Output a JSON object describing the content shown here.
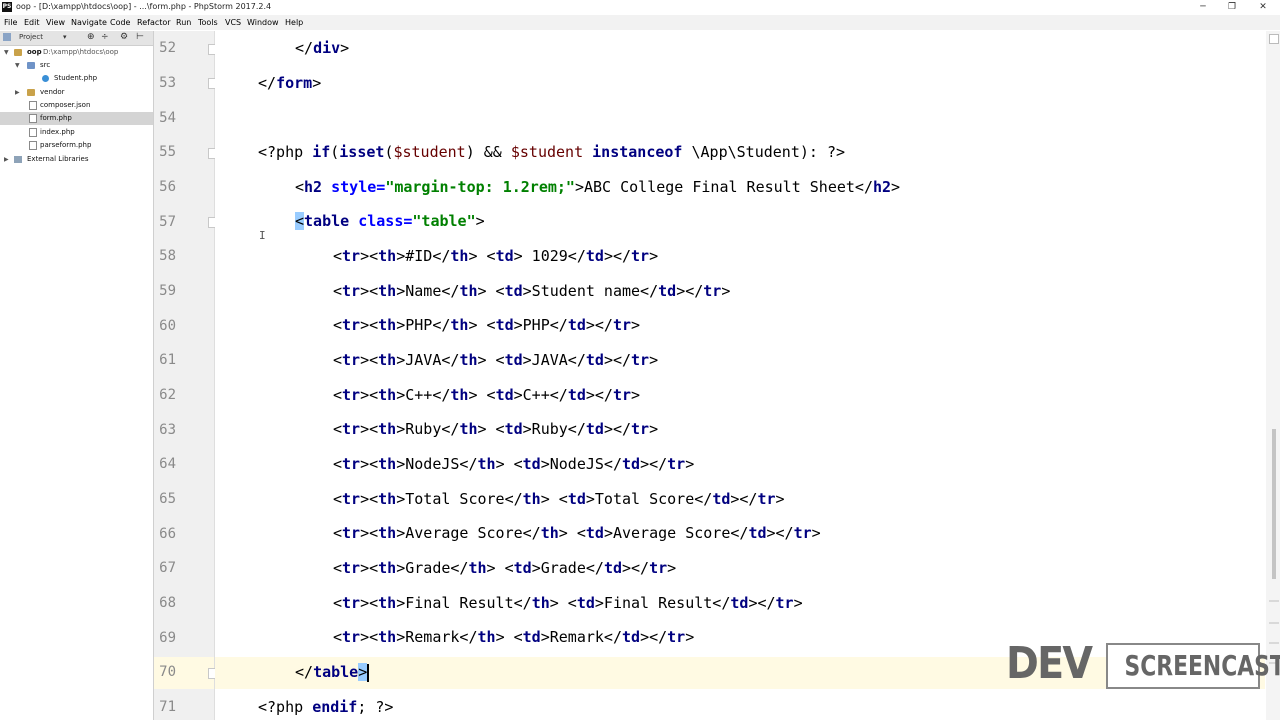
{
  "window": {
    "title": "oop - [D:\\xampp\\htdocs\\oop] - ...\\form.php - PhpStorm 2017.2.4",
    "app_icon_label": "PS",
    "minimize": "─",
    "maximize": "❐",
    "close": "✕"
  },
  "menu": [
    "File",
    "Edit",
    "View",
    "Navigate",
    "Code",
    "Refactor",
    "Run",
    "Tools",
    "VCS",
    "Window",
    "Help"
  ],
  "project_panel": {
    "header_label": "Project",
    "header_dropdown": "▾",
    "header_icons": [
      "⊕",
      "÷",
      "⚙",
      "⊢"
    ],
    "tree": [
      {
        "label": "oop  D:\\xampp\\htdocs\\oop",
        "root": "oop",
        "path": "D:\\xampp\\htdocs\\oop",
        "type": "folder",
        "expanded": true
      },
      {
        "label": "src",
        "type": "folder",
        "expanded": true
      },
      {
        "label": "Student.php",
        "type": "class"
      },
      {
        "label": "vendor",
        "type": "folder",
        "expanded": false
      },
      {
        "label": "composer.json",
        "type": "file"
      },
      {
        "label": "form.php",
        "type": "file",
        "selected": true
      },
      {
        "label": "index.php",
        "type": "file"
      },
      {
        "label": "parseform.php",
        "type": "file"
      },
      {
        "label": "External Libraries",
        "type": "library",
        "expanded": false
      }
    ]
  },
  "editor": {
    "line_numbers": [
      "52",
      "53",
      "54",
      "55",
      "56",
      "57",
      "58",
      "59",
      "60",
      "61",
      "62",
      "63",
      "64",
      "65",
      "66",
      "67",
      "68",
      "69",
      "70",
      "71"
    ],
    "current_line": "70"
  },
  "watermark": {
    "left": "DEV",
    "right": "SCREENCAST"
  }
}
